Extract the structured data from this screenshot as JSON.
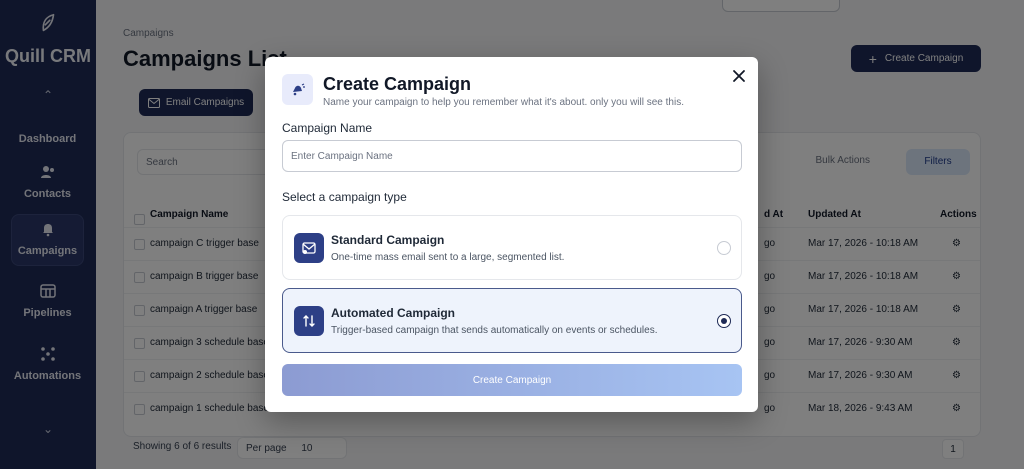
{
  "sidebar": {
    "brand": "Quill CRM",
    "items": [
      {
        "label": "Dashboard",
        "icon": "dashboard-icon"
      },
      {
        "label": "Contacts",
        "icon": "contacts-icon"
      },
      {
        "label": "Campaigns",
        "icon": "campaigns-icon"
      },
      {
        "label": "Pipelines",
        "icon": "pipelines-icon"
      },
      {
        "label": "Automations",
        "icon": "automations-icon"
      }
    ]
  },
  "page": {
    "breadcrumb": "Campaigns",
    "title": "Campaigns List",
    "create_button": "Create Campaign",
    "email_tab": "Email Campaigns",
    "search_placeholder": "Search",
    "bulk_actions": "Bulk Actions",
    "filters": "Filters",
    "columns": {
      "name": "Campaign Name",
      "last_at": "d At",
      "updated_at": "Updated At",
      "actions": "Actions"
    },
    "rows": [
      {
        "name": "campaign C trigger base",
        "last": "go",
        "updated": "Mar 17, 2026 - 10:18 AM"
      },
      {
        "name": "campaign B trigger base",
        "last": "go",
        "updated": "Mar 17, 2026 - 10:18 AM"
      },
      {
        "name": "campaign A trigger base",
        "last": "go",
        "updated": "Mar 17, 2026 - 10:18 AM"
      },
      {
        "name": "campaign 3 schedule base",
        "last": "go",
        "updated": "Mar 17, 2026 - 9:30 AM"
      },
      {
        "name": "campaign 2 schedule base",
        "last": "go",
        "updated": "Mar 17, 2026 - 9:30 AM"
      },
      {
        "name": "campaign 1 schedule base",
        "last": "go",
        "updated": "Mar 18, 2026 - 9:43 AM"
      }
    ],
    "footer_text": "Showing 6 of 6 results",
    "per_page_label": "Per page",
    "per_page_value": "10",
    "page_number": "1"
  },
  "modal": {
    "title": "Create Campaign",
    "subtitle": "Name your campaign to help you remember what it's about. only you will see this.",
    "name_label": "Campaign Name",
    "name_placeholder": "Enter Campaign Name",
    "name_value": "",
    "type_label": "Select a campaign type",
    "options": [
      {
        "title": "Standard Campaign",
        "desc": "One-time mass email sent to a large, segmented list.",
        "selected": false
      },
      {
        "title": "Automated Campaign",
        "desc": "Trigger-based campaign that sends automatically on events or schedules.",
        "selected": true
      }
    ],
    "submit_label": "Create Campaign"
  },
  "colors": {
    "primary": "#1e2a56",
    "selected_bg": "#eef3fc",
    "accent_icon": "#2d3f86"
  }
}
